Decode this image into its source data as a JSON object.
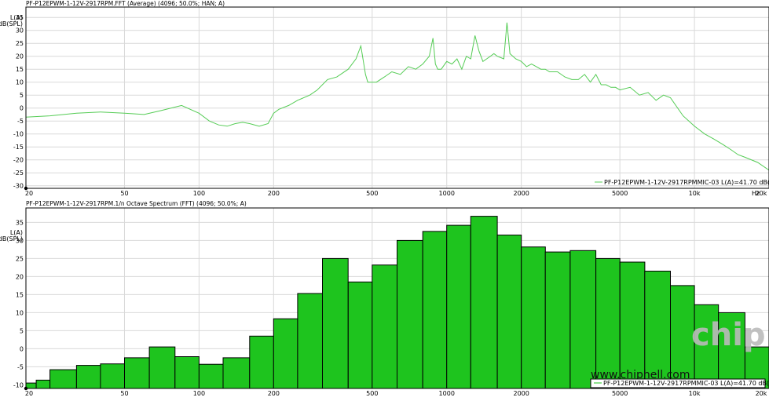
{
  "charts": {
    "fft": {
      "header": "PF-P12EPWM-1-12V-2917RPM.FFT (Average) (4096; 50.0%; HAN; A)",
      "ylabel_line1": "L(A)",
      "ylabel_line2": "dB(SPL)",
      "x_unit": "Hz",
      "legend": "PF-P12EPWM-1-12V-2917RPMMIC-03 L(A)=41.70 dB(SPL)"
    },
    "octave": {
      "header": "PF-P12EPWM-1-12V-2917RPM.1/n Octave Spectrum (FFT) (4096; 50.0%; A)",
      "ylabel_line1": "L(A)",
      "ylabel_line2": "dB(SPL)",
      "legend": "PF-P12EPWM-1-12V-2917RPMMIC-03 L(A)=41.70 dB(SPL)"
    }
  },
  "watermark": {
    "url": "www.chiphell.com",
    "logo_text": "chip hell"
  },
  "chart_data": [
    {
      "type": "line",
      "x_scale": "log",
      "xlim": [
        20,
        20000
      ],
      "ylim": [
        -31,
        39
      ],
      "grid": true,
      "legend_placement": "bottom-right",
      "x_ticks": [
        {
          "v": 20,
          "label": "20"
        },
        {
          "v": 50,
          "label": "50"
        },
        {
          "v": 100,
          "label": "100"
        },
        {
          "v": 200,
          "label": "200"
        },
        {
          "v": 500,
          "label": "500"
        },
        {
          "v": 1000,
          "label": "1000"
        },
        {
          "v": 2000,
          "label": "2000"
        },
        {
          "v": 5000,
          "label": "5000"
        },
        {
          "v": 10000,
          "label": "10k"
        },
        {
          "v": 20000,
          "label": "20k"
        }
      ],
      "y_ticks": [
        35,
        30,
        25,
        20,
        15,
        10,
        5,
        0,
        -5,
        -10,
        -15,
        -20,
        -25,
        -30
      ],
      "series": [
        {
          "color": "#55cc55",
          "x": [
            20,
            25,
            32,
            40,
            50,
            60,
            70,
            85,
            100,
            110,
            120,
            130,
            140,
            150,
            160,
            175,
            190,
            200,
            210,
            230,
            250,
            280,
            300,
            330,
            360,
            400,
            430,
            450,
            470,
            480,
            520,
            560,
            600,
            650,
            700,
            750,
            800,
            850,
            880,
            900,
            920,
            950,
            1000,
            1050,
            1100,
            1150,
            1200,
            1250,
            1300,
            1350,
            1400,
            1450,
            1500,
            1550,
            1600,
            1700,
            1750,
            1800,
            1850,
            1900,
            2000,
            2100,
            2200,
            2300,
            2400,
            2500,
            2600,
            2800,
            3000,
            3200,
            3400,
            3600,
            3800,
            4000,
            4200,
            4400,
            4600,
            4800,
            5000,
            5500,
            6000,
            6500,
            7000,
            7500,
            8000,
            9000,
            10000,
            11000,
            12000,
            13000,
            14000,
            15000,
            16000,
            18000,
            20000
          ],
          "y": [
            -3.5,
            -3,
            -2,
            -1.5,
            -2,
            -2.5,
            -1,
            1,
            -2,
            -5,
            -6.5,
            -7,
            -6,
            -5.5,
            -6,
            -7,
            -6,
            -2,
            -0.5,
            1,
            3,
            5,
            7,
            11,
            12,
            15,
            19,
            24,
            13,
            10,
            10,
            12,
            14,
            13,
            16,
            15,
            17,
            20,
            27,
            17,
            15,
            15,
            18,
            17,
            19,
            15,
            20,
            19,
            28,
            22,
            18,
            19,
            20,
            21,
            20,
            19,
            33,
            21,
            20,
            19,
            18,
            16,
            17,
            16,
            15,
            15,
            14,
            14,
            12,
            11,
            11,
            13,
            10,
            13,
            9,
            9,
            8,
            8,
            7,
            8,
            5,
            6,
            3,
            5,
            4,
            -3,
            -7,
            -10,
            -12,
            -14,
            -16,
            -18,
            -19,
            -21,
            -24
          ]
        }
      ]
    },
    {
      "type": "bar",
      "x_scale": "log",
      "xlim": [
        20,
        20000
      ],
      "ylim": [
        -11,
        39
      ],
      "grid": true,
      "legend_placement": "bottom-right",
      "x_ticks": [
        {
          "v": 20,
          "label": "20"
        },
        {
          "v": 50,
          "label": "50"
        },
        {
          "v": 100,
          "label": "100"
        },
        {
          "v": 200,
          "label": "200"
        },
        {
          "v": 500,
          "label": "500"
        },
        {
          "v": 1000,
          "label": "1000"
        },
        {
          "v": 2000,
          "label": "2000"
        },
        {
          "v": 5000,
          "label": "5000"
        },
        {
          "v": 10000,
          "label": "10k"
        },
        {
          "v": 20000,
          "label": "20k"
        }
      ],
      "y_ticks": [
        35,
        30,
        25,
        20,
        15,
        10,
        5,
        0,
        -5,
        -10
      ],
      "bar_color": "#1ec41e",
      "edges": [
        20,
        22,
        25,
        32,
        40,
        50,
        63,
        80,
        100,
        125,
        160,
        200,
        250,
        315,
        400,
        500,
        630,
        800,
        1000,
        1250,
        1600,
        2000,
        2500,
        3150,
        4000,
        5000,
        6300,
        8000,
        10000,
        12500,
        16000,
        20000
      ],
      "values": [
        -9.5,
        -8.7,
        -5.8,
        -4.6,
        -4.2,
        -2.5,
        0.5,
        -2.2,
        -4.3,
        -2.5,
        3.5,
        8.3,
        15.3,
        25.0,
        18.5,
        23.2,
        30.0,
        32.5,
        34.2,
        36.7,
        31.5,
        28.2,
        26.8,
        27.2,
        25.0,
        24.0,
        21.5,
        17.5,
        12.2,
        10.0,
        0.5
      ]
    }
  ]
}
